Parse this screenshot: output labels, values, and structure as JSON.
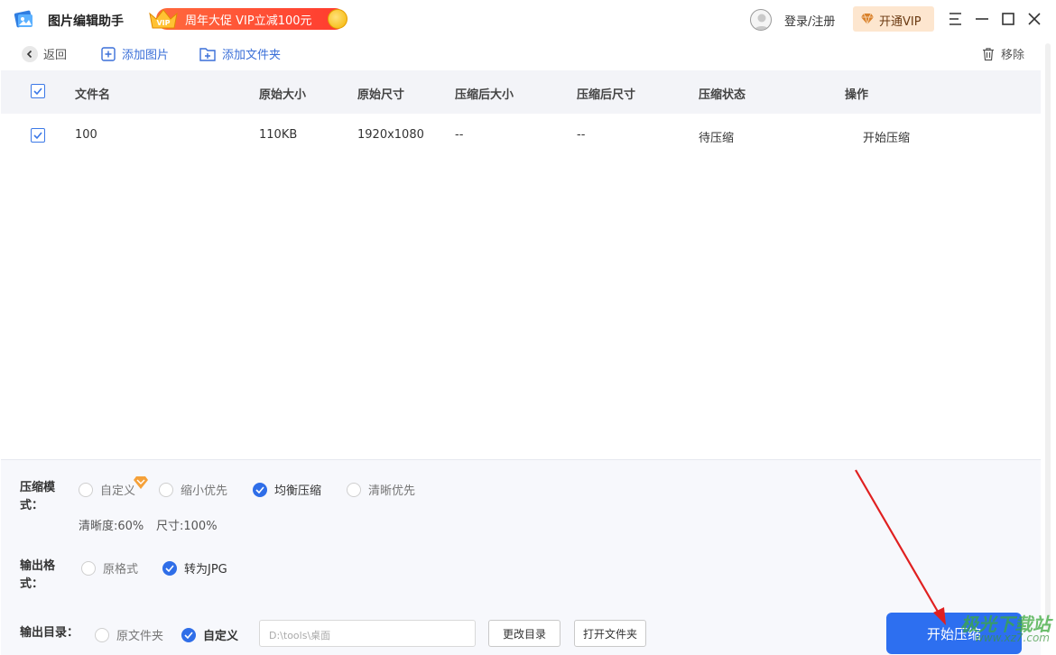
{
  "app": {
    "title": "图片编辑助手"
  },
  "promo": {
    "badge": "VIP",
    "text": "周年大促 VIP立减100元"
  },
  "header": {
    "login_label": "登录/注册",
    "vip_label": "开通VIP"
  },
  "toolbar": {
    "back_label": "返回",
    "add_image_label": "添加图片",
    "add_folder_label": "添加文件夹",
    "remove_label": "移除"
  },
  "table": {
    "columns": [
      "文件名",
      "原始大小",
      "原始尺寸",
      "压缩后大小",
      "压缩后尺寸",
      "压缩状态",
      "操作"
    ],
    "rows": [
      {
        "name": "100",
        "size": "110KB",
        "dimensions": "1920x1080",
        "compressed_size": "--",
        "compressed_dimensions": "--",
        "status": "待压缩",
        "action": "开始压缩",
        "checked": true
      }
    ],
    "all_checked": true
  },
  "settings": {
    "mode_label": "压缩模式：",
    "mode_options": [
      "自定义",
      "缩小优先",
      "均衡压缩",
      "清晰优先"
    ],
    "mode_selected": "均衡压缩",
    "clarity_hint": "清晰度:60%",
    "size_hint": "尺寸:100%",
    "format_label": "输出格式：",
    "format_options": [
      "原格式",
      "转为JPG"
    ],
    "format_selected": "转为JPG",
    "dir_label": "输出目录：",
    "dir_options": [
      "原文件夹",
      "自定义"
    ],
    "dir_selected": "自定义",
    "dir_path_placeholder": "D:\\tools\\桌面",
    "change_dir_label": "更改目录",
    "open_folder_label": "打开文件夹",
    "start_label": "开始压缩"
  },
  "watermark": {
    "text": "极光下载站",
    "sub": "www.xz7.com"
  },
  "colors": {
    "accent": "#2d6ff0",
    "promo": "#ff4a34",
    "vip_bg": "#fde6cf",
    "annotation_arrow": "#e02020"
  }
}
